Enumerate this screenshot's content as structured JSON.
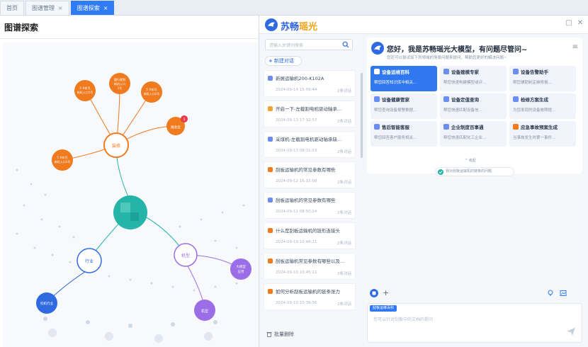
{
  "tabs": [
    {
      "label": "首页",
      "active": false,
      "closable": false
    },
    {
      "label": "图谱管理",
      "active": false,
      "closable": true
    },
    {
      "label": "图谱探索",
      "active": true,
      "closable": true
    }
  ],
  "page_title": "图谱探索",
  "graph": {
    "nodes": [
      {
        "label": "装修",
        "color": "#f07a1e"
      },
      {
        "label": "5 #机\n号\n新\n机\n入\n口\n1",
        "color": "#f07a1e"
      },
      {
        "label": "酸\n行\n规\n划\n新\n机\n入",
        "color": "#f07a1e"
      },
      {
        "label": "5 #机\n号\n新\n机\n入\n口\n1",
        "color": "#f07a1e"
      },
      {
        "label": "5 #机\n号\n新\n机\n入\n口\n1",
        "color": "#f07a1e"
      },
      {
        "label": "酸盐型",
        "color": "#f07a1e"
      },
      {
        "label": "行业",
        "color": "#2f6ae0"
      },
      {
        "label": "机型",
        "color": "#9b6ee8"
      },
      {
        "label": "综机行业",
        "color": "#2f6ae0"
      },
      {
        "label": "大模型\n应用",
        "color": "#9b6ee8"
      },
      {
        "label": "机型",
        "color": "#9b6ee8"
      }
    ],
    "badge": "1",
    "colors": {
      "orange": "#f07a1e",
      "teal": "#24b5a8",
      "blue": "#2f6ae0",
      "purple": "#9b6ee8"
    }
  },
  "assistant": {
    "brand_main": "苏畅",
    "brand_accent": "瑶光",
    "search_placeholder": "请输入关键词搜索",
    "new_chat_label": "新建对话",
    "conversations": [
      {
        "title": "新展运输机200-K102A",
        "date": "2024-09-14 15:09:44",
        "count": "2条对话",
        "icon_color": "#6b8df2"
      },
      {
        "title": "开启一下-左截割电机驱动轴承...",
        "date": "2024-09-13 17:32:57",
        "count": "2条对话",
        "icon_color": "#f0a53a"
      },
      {
        "title": "采煤机-左截割电机驱动轴承缺...",
        "date": "2024-09-13 08:31:13",
        "count": "2条对话",
        "icon_color": "#6b8df2"
      },
      {
        "title": "刮板运输机的常见参数有哪些",
        "date": "2024-09-12 16:32:08",
        "count": "2条对话",
        "icon_color": "#f07a1e"
      },
      {
        "title": "刮板运输机的常见参数有哪些",
        "date": "2024-09-11 08:50:24",
        "count": "2条对话",
        "icon_color": "#6b8df2"
      },
      {
        "title": "什么是刮板运输机的链形连接头",
        "date": "2024-09-10 10:46:21",
        "count": "2条对话",
        "icon_color": "#f07a1e"
      },
      {
        "title": "刮板运输机常见参数有哪些以及...",
        "date": "2024-09-10 10:45:11",
        "count": "2条对话",
        "icon_color": "#f07a1e"
      },
      {
        "title": "如何分析刮板运输机的链条张力",
        "date": "2024-09-10 10:39:56",
        "count": "2条对话",
        "icon_color": "#f07a1e"
      }
    ],
    "batch_delete_label": "批量删除",
    "welcome_title": "您好，我是苏畅瑶光大模型，有问题尽管问~",
    "welcome_subtitle": "您还可以尝试如下列领域的场景问题来提问，帮助您更好的解决问题~",
    "cards": [
      {
        "title": "设备运维百科",
        "desc": "帮您回答知识库中相关...",
        "icon_color": "#ffffff",
        "active": true
      },
      {
        "title": "设备建模专家",
        "desc": "帮您快速构建模型或评...",
        "icon_color": "#6b8df2",
        "active": false
      },
      {
        "title": "设备告警助手",
        "desc": "帮您辅助制定维修报...",
        "icon_color": "#6b8df2",
        "active": false
      },
      {
        "title": "设备健康管家",
        "desc": "帮您查询设备报警数据...",
        "icon_color": "#6b8df2",
        "active": false
      },
      {
        "title": "设备定值查询",
        "desc": "帮您快速匹配设备信...",
        "icon_color": "#6b8df2",
        "active": false
      },
      {
        "title": "检修方案生成",
        "desc": "为您发现的设备故障提...",
        "icon_color": "#6b8df2",
        "active": false
      },
      {
        "title": "售后智能客服",
        "desc": "帮您回答客户服务相关...",
        "icon_color": "#6b8df2",
        "active": false
      },
      {
        "title": "企业制度百事通",
        "desc": "帮您快速匹配化工企业...",
        "icon_color": "#6b8df2",
        "active": false
      },
      {
        "title": "应急事故预案生成",
        "desc": "当事故发生时第一事件...",
        "icon_color": "#f07a1e",
        "active": false
      }
    ],
    "collapse_label": "^ 收起",
    "notice_text": "我对刮板运输机的链条的问题",
    "input_chip": "刮板运维百科",
    "input_placeholder": "您可以针对刮板中的文档的提问",
    "accent": "#2f78f0"
  }
}
